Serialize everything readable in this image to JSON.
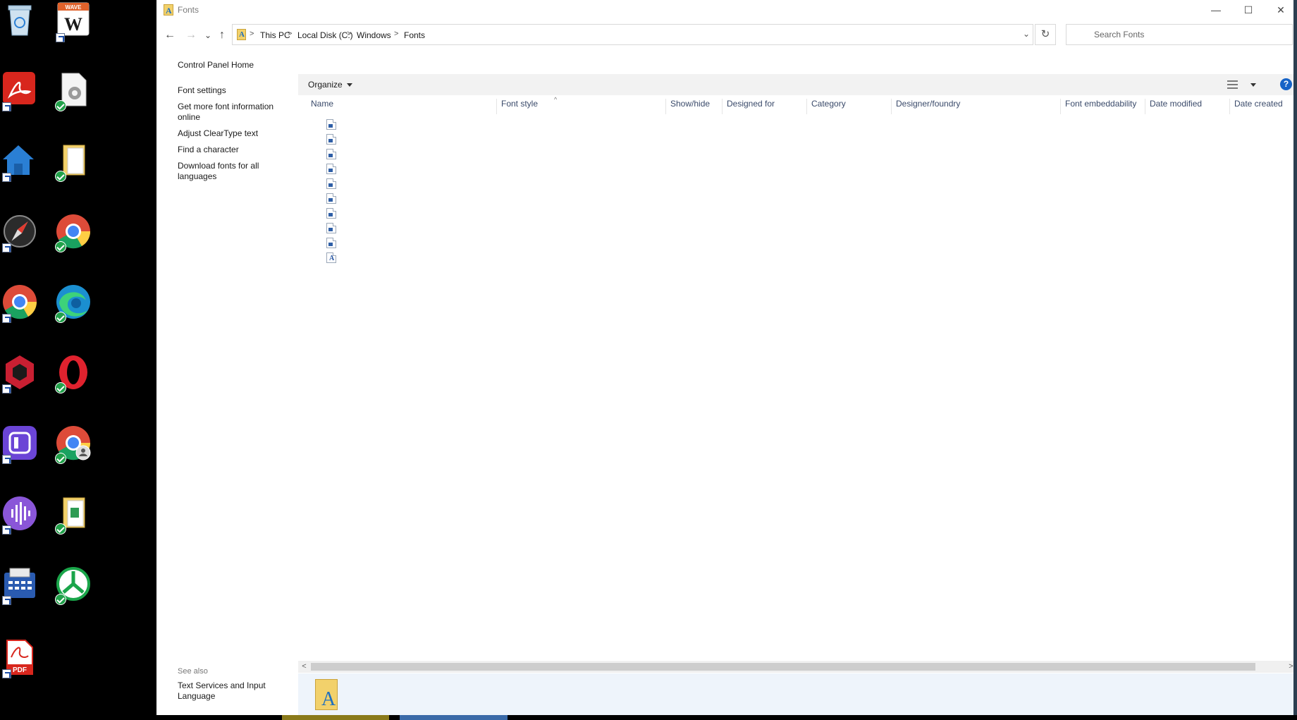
{
  "desktop": {
    "icons": [
      {
        "name": "recycle-bin-icon",
        "label": "",
        "color": "#8fb8d8",
        "badge": "none"
      },
      {
        "name": "wave-word-icon",
        "label": "WAVE",
        "color": "#c8432b",
        "badge": "shortcut"
      },
      {
        "name": "acrobat-icon",
        "label": "",
        "color": "#d8261d",
        "badge": "shortcut"
      },
      {
        "name": "settings-document-icon",
        "label": "",
        "color": "#e8e8e8",
        "badge": "check"
      },
      {
        "name": "home-icon",
        "label": "",
        "color": "#2a7fd4",
        "badge": "shortcut"
      },
      {
        "name": "folder-documents-icon",
        "label": "",
        "color": "#f2d16b",
        "badge": "check"
      },
      {
        "name": "compass-icon",
        "label": "",
        "color": "#3a3a3a",
        "badge": "shortcut"
      },
      {
        "name": "chrome-icon",
        "label": "",
        "color": "#dd4b39",
        "badge": "check"
      },
      {
        "name": "chrome-icon-2",
        "label": "",
        "color": "#dd4b39",
        "badge": "shortcut"
      },
      {
        "name": "edge-icon",
        "label": "",
        "color": "#1fa7a3",
        "badge": "check"
      },
      {
        "name": "red-hexagon-app-icon",
        "label": "",
        "color": "#d1263a",
        "badge": "shortcut"
      },
      {
        "name": "opera-icon",
        "label": "",
        "color": "#e0222e",
        "badge": "check"
      },
      {
        "name": "purple-app-icon",
        "label": "",
        "color": "#7a4fd8",
        "badge": "shortcut"
      },
      {
        "name": "chrome-profile-icon",
        "label": "",
        "color": "#dd4b39",
        "badge": "check"
      },
      {
        "name": "voice-recorder-icon",
        "label": "",
        "color": "#8a56d8",
        "badge": "shortcut"
      },
      {
        "name": "folder-spreadsheet-icon",
        "label": "",
        "color": "#f2d16b",
        "badge": "check"
      },
      {
        "name": "calculator-app-icon",
        "label": "",
        "color": "#2a5bb0",
        "badge": "shortcut"
      },
      {
        "name": "green-sync-icon",
        "label": "",
        "color": "#1aa54a",
        "badge": "check"
      },
      {
        "name": "pdf-file-icon",
        "label": "PDF",
        "color": "#d8261d",
        "badge": "shortcut"
      }
    ]
  },
  "window": {
    "title": "Fonts",
    "controls": {
      "minimize": "—",
      "maximize": "☐",
      "close": "✕"
    }
  },
  "nav": {
    "back": "←",
    "forward": "→",
    "recent": "⌄",
    "up": "↑",
    "breadcrumb": [
      "This PC",
      "Local Disk (C:)",
      "Windows",
      "Fonts"
    ],
    "separator": ">",
    "dropdown": "⌄",
    "refresh": "↻",
    "search_placeholder": "Search Fonts"
  },
  "left_pane": {
    "home": "Control Panel Home",
    "links": [
      "Font settings",
      "Get more font information online",
      "Adjust ClearType text",
      "Find a character",
      "Download fonts for all languages"
    ],
    "see_also_label": "See also",
    "see_also_links": [
      "Text Services and Input Language"
    ]
  },
  "toolbar": {
    "organize": "Organize",
    "help": "?"
  },
  "columns": [
    "Name",
    "Font style",
    "Show/hide",
    "Designed for",
    "Category",
    "Designer/foundry",
    "Font embeddability",
    "Date modified",
    "Date created"
  ],
  "sort_indicator": "^",
  "files": [
    {
      "type": "font-file"
    },
    {
      "type": "font-file"
    },
    {
      "type": "font-file"
    },
    {
      "type": "font-file"
    },
    {
      "type": "font-file"
    },
    {
      "type": "font-file"
    },
    {
      "type": "font-file"
    },
    {
      "type": "font-file"
    },
    {
      "type": "font-file"
    },
    {
      "type": "font-a-file"
    }
  ],
  "scrollbar": {
    "left": "<",
    "right": ">"
  },
  "details_pane": {
    "icon": "fonts-folder-icon",
    "glyph": "A"
  }
}
